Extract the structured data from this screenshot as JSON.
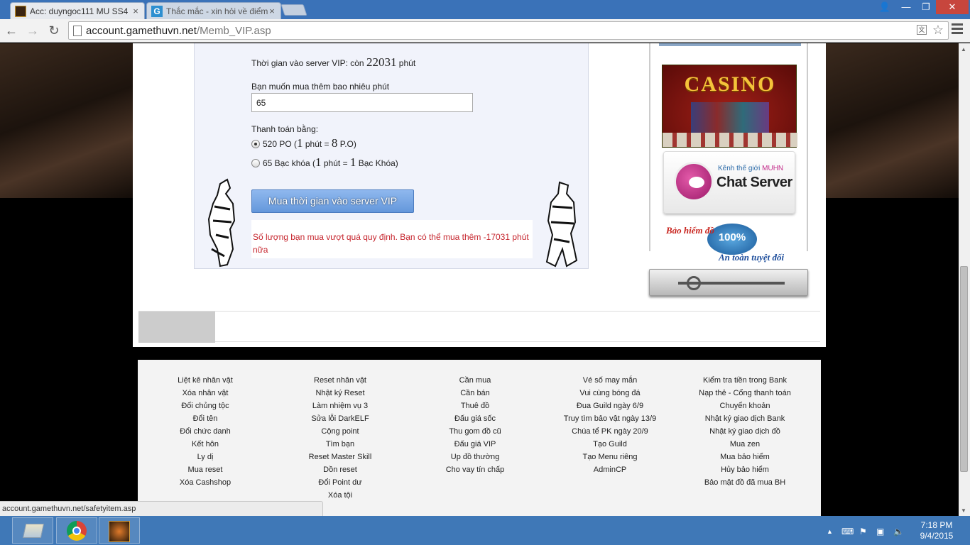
{
  "browser": {
    "tabs": [
      {
        "title": "Acc: duyngoc111 MU SS4"
      },
      {
        "title": "Thắc mắc - xin hỏi về điểm"
      }
    ],
    "url_host": "account.gamethuvn.net",
    "url_path": "/Memb_VIP.asp"
  },
  "vip": {
    "time_label": "Thời gian vào server VIP: còn",
    "time_value": "22031",
    "time_unit": "phút",
    "buy_question": "Bạn muốn mua thêm bao nhiêu phút",
    "qty_value": "65",
    "pay_label": "Thanh toán bằng:",
    "options": [
      {
        "amount": "520 PO (",
        "rate_a": "1",
        "mid": " phút = ",
        "rate_b": "8",
        "unit": " P.O)",
        "selected": true
      },
      {
        "amount": "65 Bạc khóa (",
        "rate_a": "1",
        "mid": " phút = ",
        "rate_b": "1",
        "unit": " Bạc Khóa)",
        "selected": false
      }
    ],
    "buy_button": "Mua thời gian vào server VIP",
    "error": "Số lượng bạn mua vượt quá quy định. Bạn có thể mua thêm -17031 phút nữa"
  },
  "sidebar": {
    "casino": "CASINO",
    "chat_small_prefix": "Kênh thế giới",
    "chat_small_brand": "MUHN",
    "chat_big": "Chat Server",
    "insure_top": "Bảo hiểm đồ",
    "insure_seal": "100%",
    "insure_bottom": "An toàn tuyệt đối"
  },
  "footer": {
    "columns": [
      [
        "Liệt kê nhân vật",
        "Xóa nhân vật",
        "Đổi chủng tộc",
        "Đổi tên",
        "Đổi chức danh",
        "Kết hôn",
        "Ly dị",
        "Mua reset",
        "Xóa Cashshop"
      ],
      [
        "Reset nhân vật",
        "Nhật ký Reset",
        "Làm nhiệm vụ 3",
        "Sửa lỗi DarkELF",
        "Cộng point",
        "Tìm bạn",
        "Reset Master Skill",
        "Dồn reset",
        "Đổi Point dư",
        "Xóa tội"
      ],
      [
        "Cần mua",
        "Cần bán",
        "Thuê đồ",
        "Đấu giá sốc",
        "Thu gom đồ cũ",
        "Đấu giá VIP",
        "Up đồ thường",
        "Cho vay tín chấp"
      ],
      [
        "Vé số may mắn",
        "Vui cùng bóng đá",
        "Đua Guild ngày 6/9",
        "Truy tìm bảo vật ngày 13/9",
        "Chúa tể PK ngày 20/9",
        "Tạo Guild",
        "Tạo Menu riêng",
        "AdminCP"
      ],
      [
        "Kiểm tra tiền trong Bank",
        "Nạp thẻ - Cổng thanh toán",
        "Chuyển khoản",
        "Nhật ký giao dịch Bank",
        "Nhật ký giao dịch đồ",
        "Mua zen",
        "Mua bảo hiểm",
        "Hủy bảo hiểm",
        "Bảo mật đồ đã mua BH"
      ]
    ]
  },
  "status_url": "account.gamethuvn.net/safetyitem.asp",
  "clock": {
    "time": "7:18 PM",
    "date": "9/4/2015"
  },
  "colors": {
    "taskbar": "#3f78b7",
    "error": "#c6262e",
    "button": "#6497db"
  }
}
